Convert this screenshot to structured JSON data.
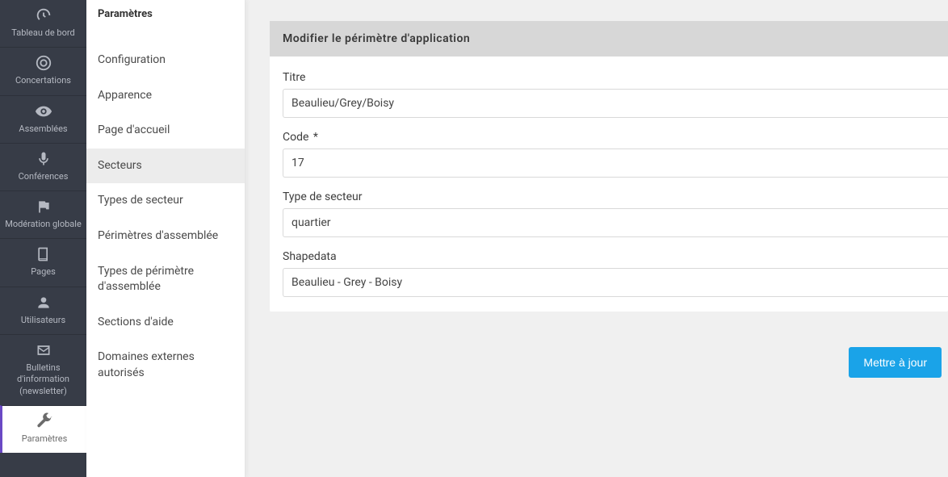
{
  "rail": {
    "items": [
      {
        "label": "Tableau de bord",
        "icon": "gauge"
      },
      {
        "label": "Concertations",
        "icon": "target"
      },
      {
        "label": "Assemblées",
        "icon": "eye"
      },
      {
        "label": "Conférences",
        "icon": "mic"
      },
      {
        "label": "Modération globale",
        "icon": "flag"
      },
      {
        "label": "Pages",
        "icon": "book"
      },
      {
        "label": "Utilisateurs",
        "icon": "user"
      },
      {
        "label": "Bulletins d'information (newsletter)",
        "icon": "mail"
      },
      {
        "label": "Paramètres",
        "icon": "wrench"
      }
    ],
    "activeIndex": 8
  },
  "sidebar": {
    "title": "Paramètres",
    "items": [
      "Configuration",
      "Apparence",
      "Page d'accueil",
      "Secteurs",
      "Types de secteur",
      "Périmètres d'assemblée",
      "Types de périmètre d'assemblée",
      "Sections d'aide",
      "Domaines externes autorisés"
    ],
    "activeIndex": 3
  },
  "form": {
    "title": "Modifier le périmètre d'application",
    "fields": {
      "titre": {
        "label": "Titre",
        "value": "Beaulieu/Grey/Boisy"
      },
      "code": {
        "label": "Code",
        "required": "*",
        "value": "17"
      },
      "type": {
        "label": "Type de secteur",
        "value": "quartier"
      },
      "shapedata": {
        "label": "Shapedata",
        "value": "Beaulieu - Grey - Boisy"
      }
    },
    "submit": "Mettre à jour"
  }
}
